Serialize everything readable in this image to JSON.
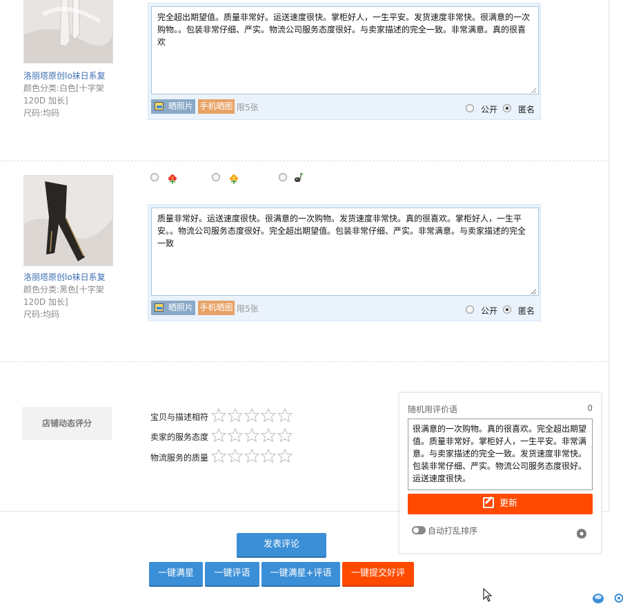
{
  "items": [
    {
      "product_name": "洛丽塔原创lo袜日系复",
      "color_label": "颜色分类:白色[十字架",
      "color_cont": "120D 加长]",
      "size_label": "尺码:均码",
      "review_text": "完全超出期望值。质量非常好。运送速度很快。掌柜好人，一生平安。发货速度非常快。很满意的一次购物。。包装非常仔细、严实。物流公司服务态度很好。与卖家描述的完全一致。非常满意。真的很喜欢",
      "photo_label": "晒照片",
      "mobile_label": "手机晒图",
      "limit_label": "限5张",
      "public_label": "公开",
      "anon_label": "匿名"
    },
    {
      "product_name": "洛丽塔原创lo袜日系复",
      "color_label": "颜色分类:黑色[十字架",
      "color_cont": "120D 加长]",
      "size_label": "尺码:均码",
      "review_text": "质量非常好。运送速度很快。很满意的一次购物。发货速度非常快。真的很喜欢。掌柜好人，一生平安。。物流公司服务态度很好。完全超出期望值。包装非常仔细、严实。非常满意。与卖家描述的完全一致",
      "photo_label": "晒照片",
      "mobile_label": "手机晒图",
      "limit_label": "限5张",
      "public_label": "公开",
      "anon_label": "匿名"
    }
  ],
  "rating_icons": [
    "red-flower-icon",
    "yellow-flower-icon",
    "wilted-flower-icon"
  ],
  "shop_rating": {
    "title": "店铺动态评分",
    "rows": [
      {
        "label": "宝贝与描述相符",
        "stars": 0
      },
      {
        "label": "卖家的服务态度",
        "stars": 0
      },
      {
        "label": "物流服务的质量",
        "stars": 0
      }
    ]
  },
  "buttons": {
    "submit": "发表评论",
    "one_click_stars": "一键满星",
    "one_click_review": "一键评语",
    "one_click_both": "一键满星+评语",
    "one_click_submit": "一键提交好评"
  },
  "panel": {
    "title": "随机用评价语",
    "count": "0",
    "text": "很满意的一次购物。真的很喜欢。完全超出期望值。质量非常好。掌柜好人，一生平安。非常满意。与卖家描述的完全一致。发货速度非常快。包装非常仔细、严实。物流公司服务态度很好。运送速度很快。",
    "update_label": "更新",
    "shuffle_label": "自动打乱排序"
  },
  "colors": {
    "accent_blue": "#3b8fd6",
    "accent_red": "#ff4a00",
    "link_blue": "#3b6db0"
  }
}
